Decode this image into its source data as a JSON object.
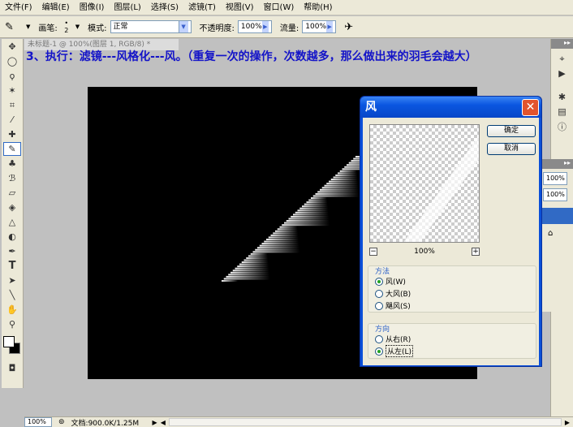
{
  "menu": [
    "文件(F)",
    "编辑(E)",
    "图像(I)",
    "图层(L)",
    "选择(S)",
    "滤镜(T)",
    "视图(V)",
    "窗口(W)",
    "帮助(H)"
  ],
  "options": {
    "brush_label": "画笔:",
    "brush_size": "2",
    "mode_label": "模式:",
    "mode_value": "正常",
    "opacity_label": "不透明度:",
    "opacity_value": "100%",
    "flow_label": "流量:",
    "flow_value": "100%"
  },
  "document": {
    "title": "未标题-1 @ 100%(图层 1, RGB/8) *"
  },
  "instruction": "3、执行：滤镜---风格化---风。（重复一次的操作，次数越多，那么做出来的羽毛会越大）",
  "status": {
    "zoom": "100%",
    "doc_info": "文档:900.0K/1.25M"
  },
  "dialog": {
    "title": "风",
    "ok": "确定",
    "cancel": "取消",
    "preview_zoom": "100%",
    "method_label": "方法",
    "methods": [
      "风(W)",
      "大风(B)",
      "飓风(S)"
    ],
    "method_selected": 0,
    "direction_label": "方向",
    "directions": [
      "从右(R)",
      "从左(L)"
    ],
    "direction_selected": 1
  },
  "panels": {
    "p1": "100%",
    "p2": "100%"
  },
  "colors": {
    "instruction_text": "#1414c8",
    "title_bar": "#0a56e0",
    "close_button": "#e2542e"
  }
}
